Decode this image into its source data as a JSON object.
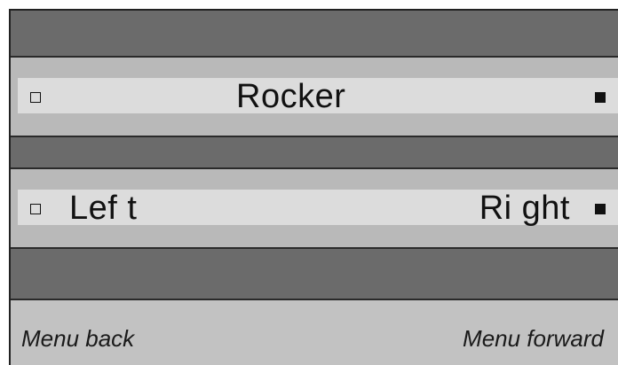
{
  "rocker_row": {
    "label": "Rocker",
    "left_indicator": "empty-square-icon",
    "right_indicator": "filled-square-icon"
  },
  "leftright_row": {
    "left_label": "Lef t",
    "right_label": "Ri ght",
    "left_indicator": "empty-square-icon",
    "right_indicator": "filled-square-icon"
  },
  "footer": {
    "back_label": "Menu back",
    "forward_label": "Menu forward"
  },
  "colors": {
    "background_dark": "#6b6b6b",
    "band": "#b9b9b9",
    "strip": "#dcdcdc",
    "footer": "#c2c2c2",
    "text": "#111111"
  }
}
